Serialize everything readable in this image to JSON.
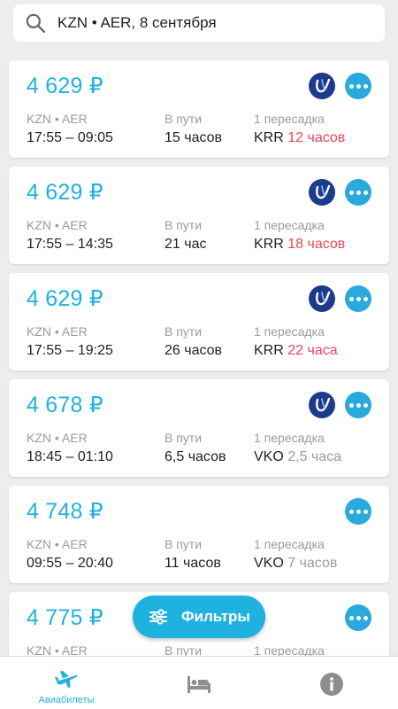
{
  "search": {
    "text": "KZN • AER, 8 сентября"
  },
  "colors": {
    "accent": "#1fb2df",
    "layover_warn": "#e94556",
    "layover_ok": "#9a9a9a",
    "airline_ut": "#1d3b8c"
  },
  "labels": {
    "route": "KZN • AER",
    "duration": "В пути",
    "stops": "1 пересадка"
  },
  "tickets": [
    {
      "price": "4 629 ₽",
      "times": "17:55 – 09:05",
      "duration": "15 часов",
      "stop_code": "KRR",
      "stop_wait": "12 часов",
      "wait_style": "red",
      "airlines": [
        "utair-logo-icon",
        "more-airlines-icon"
      ]
    },
    {
      "price": "4 629 ₽",
      "times": "17:55 – 14:35",
      "duration": "21 час",
      "stop_code": "KRR",
      "stop_wait": "18 часов",
      "wait_style": "red",
      "airlines": [
        "utair-logo-icon",
        "more-airlines-icon"
      ]
    },
    {
      "price": "4 629 ₽",
      "times": "17:55 – 19:25",
      "duration": "26 часов",
      "stop_code": "KRR",
      "stop_wait": "22 часа",
      "wait_style": "red",
      "airlines": [
        "utair-logo-icon",
        "more-airlines-icon"
      ]
    },
    {
      "price": "4 678 ₽",
      "times": "18:45 – 01:10",
      "duration": "6,5 часов",
      "stop_code": "VKO",
      "stop_wait": "2,5 часа",
      "wait_style": "gray",
      "airlines": [
        "utair-logo-icon",
        "more-airlines-icon"
      ]
    },
    {
      "price": "4 748 ₽",
      "times": "09:55 – 20:40",
      "duration": "11 часов",
      "stop_code": "VKO",
      "stop_wait": "7 часов",
      "wait_style": "gray",
      "airlines": [
        "more-airlines-icon"
      ]
    },
    {
      "price": "4 775 ₽",
      "times": "",
      "duration": "",
      "stop_code": "",
      "stop_wait": "",
      "wait_style": "gray",
      "airlines": [
        "more-airlines-icon"
      ]
    }
  ],
  "fab": {
    "label": "Фильтры",
    "icon": "filter-sliders-icon"
  },
  "bottom_nav": [
    {
      "label": "Авиабилеты",
      "icon": "airplane-icon",
      "active": true
    },
    {
      "label": "",
      "icon": "hotel-bed-icon",
      "active": false
    },
    {
      "label": "",
      "icon": "info-icon",
      "active": false
    }
  ]
}
